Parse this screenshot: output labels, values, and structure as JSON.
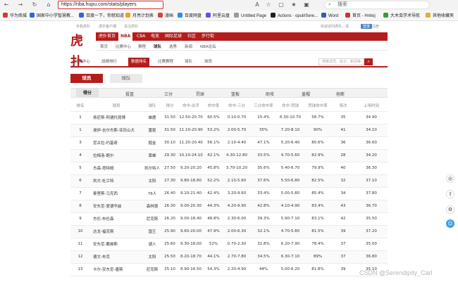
{
  "browser": {
    "url": "https://nba.hupu.com/stats/players",
    "search_placeholder": "搜索",
    "bookmarks": [
      {
        "label": "华为商城",
        "color": "#d33"
      },
      {
        "label": "国家中小学智慧教...",
        "color": "#2d6bd6"
      },
      {
        "label": "百度一下，你就知道",
        "color": "#3263e0"
      },
      {
        "label": "月亮计划表",
        "color": "#f0a020"
      },
      {
        "label": "漫画",
        "color": "#e04040"
      },
      {
        "label": "百度网盘",
        "color": "#2a8ee8"
      },
      {
        "label": "阿里云盘",
        "color": "#6a4df0"
      },
      {
        "label": "Untitled Page",
        "color": "#999"
      },
      {
        "label": "Actions · opuil/Sere...",
        "color": "#222"
      },
      {
        "label": "Word",
        "color": "#2b5fb3"
      },
      {
        "label": "首页 - Hnitoj",
        "color": "#c33"
      },
      {
        "label": "大木虫学术导航",
        "color": "#3a9a3a"
      },
      {
        "label": "其他收藏夹",
        "color": "#e0b030"
      }
    ]
  },
  "topbar": {
    "mobile": "手机虎扑",
    "app": "虎扑客户端",
    "follow": "关注虎扑",
    "welcome": "欢迎访问虎扑，请",
    "login": "登录",
    "register": "注册"
  },
  "logo": "虎扑",
  "mainnav": [
    "虎扑首页",
    "NBA",
    "CBA",
    "电竞",
    "国际足球",
    "社区",
    "步行街"
  ],
  "subnav": [
    "首页",
    "比赛中心",
    "赛程",
    "球队",
    "选秀",
    "新闻",
    "NBA论坛"
  ],
  "section_tabs": [
    "比赛中心",
    "战绩排行",
    "数据排名",
    "比赛赛程",
    "球队",
    "球员"
  ],
  "site_search_placeholder": "搜索球员、帖子、新闻等",
  "player_tabs": {
    "active": "球员",
    "inactive": "球队"
  },
  "sort_bar": [
    "得分",
    "篮板",
    "助攻",
    "盖帽",
    "抢断",
    "投篮",
    "三分",
    "罚球",
    "篮板",
    "助攻",
    "盖帽",
    "抢断"
  ],
  "sort_labels": {
    "score": "得分",
    "shoot": "投篮",
    "three": "三分",
    "ft": "罚球",
    "reb": "篮板",
    "ast": "助攻",
    "blk": "盖帽",
    "stl": "抢断"
  },
  "table": {
    "headers": [
      "排名",
      "球员",
      "球队",
      "得分",
      "命中-出手",
      "命中率",
      "命中-三分",
      "三分命中率",
      "命中-罚球",
      "罚球命中率",
      "场次",
      "上场时间"
    ],
    "rows": [
      [
        "1",
        "扬尼斯-阿德托昆博",
        "雄鹿",
        "31.50",
        "12.50-20.70",
        "60.5%",
        "0.10-0.70",
        "15.4%",
        "6.30-10.70",
        "58.7%",
        "35",
        "34.90"
      ],
      [
        "1",
        "谢伊-吉尔杰斯-亚历山大",
        "雷霆",
        "31.50",
        "11.10-20.90",
        "53.2%",
        "2.00-5.70",
        "35%",
        "7.20-8.10",
        "90%",
        "41",
        "34.10"
      ],
      [
        "3",
        "尼古拉-约基奇",
        "掘金",
        "30.10",
        "11.20-20.40",
        "56.1%",
        "2.10-4.40",
        "47.1%",
        "5.20-6.40",
        "80.6%",
        "36",
        "36.60"
      ],
      [
        "4",
        "拉梅洛-鲍尔",
        "黄蜂",
        "29.30",
        "10.10-24.10",
        "42.1%",
        "4.30-12.80",
        "33.5%",
        "4.70-5.60",
        "82.9%",
        "28",
        "34.20"
      ],
      [
        "5",
        "杰森-塔特姆",
        "凯尔特人",
        "27.50",
        "9.20-20.20",
        "45.8%",
        "3.70-10.20",
        "35.6%",
        "5.40-6.70",
        "79.9%",
        "40",
        "36.30"
      ],
      [
        "6",
        "凯文-杜兰特",
        "太阳",
        "27.30",
        "9.80-18.80",
        "52.2%",
        "2.10-5.60",
        "37.6%",
        "5.50-6.80",
        "82.5%",
        "32",
        "37.10"
      ],
      [
        "7",
        "泰里斯-马克西",
        "76人",
        "26.40",
        "9.10-21.40",
        "42.4%",
        "3.20-9.60",
        "33.4%",
        "5.00-5.80",
        "85.4%",
        "34",
        "37.80"
      ],
      [
        "8",
        "安东尼-爱德华兹",
        "森林狼",
        "26.30",
        "9.00-20.30",
        "44.3%",
        "4.20-9.90",
        "42.8%",
        "4.10-4.90",
        "83.4%",
        "43",
        "36.70"
      ],
      [
        "9",
        "杰伦-布伦森",
        "尼克斯",
        "26.20",
        "9.00-18.40",
        "48.8%",
        "2.30-6.00",
        "39.3%",
        "5.90-7.10",
        "83.1%",
        "42",
        "35.50"
      ],
      [
        "10",
        "达龙-福克斯",
        "国王",
        "25.90",
        "9.60-20.00",
        "47.9%",
        "2.00-6.30",
        "32.1%",
        "4.70-5.80",
        "81.5%",
        "39",
        "37.20"
      ],
      [
        "11",
        "安东尼-戴维斯",
        "湖人",
        "25.60",
        "9.30-18.00",
        "52%",
        "0.70-2.30",
        "31.8%",
        "6.20-7.90",
        "78.4%",
        "37",
        "35.00"
      ],
      [
        "12",
        "德文-布克",
        "太阳",
        "25.50",
        "8.20-18.70",
        "44.1%",
        "2.70-7.80",
        "34.5%",
        "6.30-7.10",
        "89%",
        "37",
        "36.80"
      ],
      [
        "13",
        "卡尔-安东尼-唐斯",
        "尼克斯",
        "25.10",
        "8.90-16.50",
        "54.3%",
        "2.20-4.90",
        "44%",
        "5.00-6.20",
        "81.8%",
        "39",
        "35.10"
      ]
    ]
  },
  "watermark": "CSDN @Serendipity_Carl"
}
